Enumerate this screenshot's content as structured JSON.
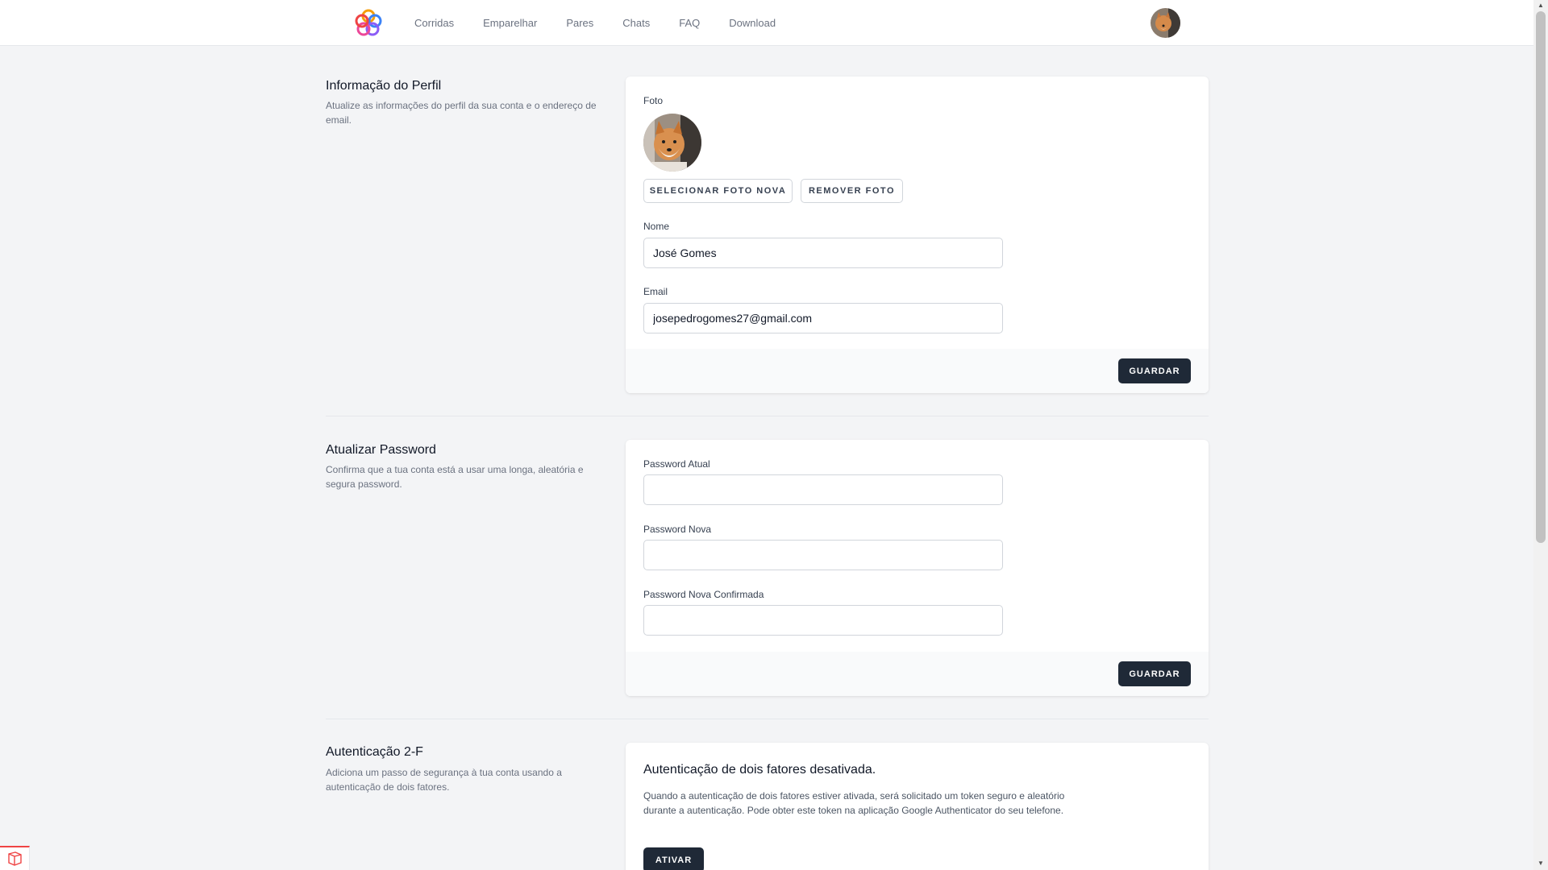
{
  "nav": {
    "links": [
      "Corridas",
      "Emparelhar",
      "Pares",
      "Chats",
      "FAQ",
      "Download"
    ],
    "logo_icon": "flower-logo-icon",
    "avatar_icon": "user-avatar-icon"
  },
  "profile": {
    "title": "Informação do Perfil",
    "description": "Atualize as informações do perfil da sua conta e o endereço de email.",
    "photo_label": "Foto",
    "select_photo_label": "SELECIONAR FOTO NOVA",
    "remove_photo_label": "REMOVER FOTO",
    "name_label": "Nome",
    "name_value": "José Gomes",
    "email_label": "Email",
    "email_value": "josepedrogomes27@gmail.com",
    "save_label": "GUARDAR"
  },
  "password": {
    "title": "Atualizar Password",
    "description": "Confirma que a tua conta está a usar uma longa, aleatória e segura password.",
    "current_label": "Password Atual",
    "new_label": "Password Nova",
    "confirm_label": "Password Nova Confirmada",
    "save_label": "GUARDAR"
  },
  "twofa": {
    "title": "Autenticação 2-F",
    "description": "Adiciona um passo de segurança à tua conta usando a autenticação de dois fatores.",
    "heading": "Autenticação de dois fatores desativada.",
    "text": "Quando a autenticação de dois fatores estiver ativada, será solicitado um token seguro e aleatório durante a autenticação. Pode obter este token na aplicação Google Authenticator do seu telefone.",
    "activate_label": "ATIVAR"
  },
  "colors": {
    "background": "#f3f4f6",
    "card": "#ffffff",
    "dark_button": "#1f2937",
    "muted_text": "#6b7280"
  }
}
